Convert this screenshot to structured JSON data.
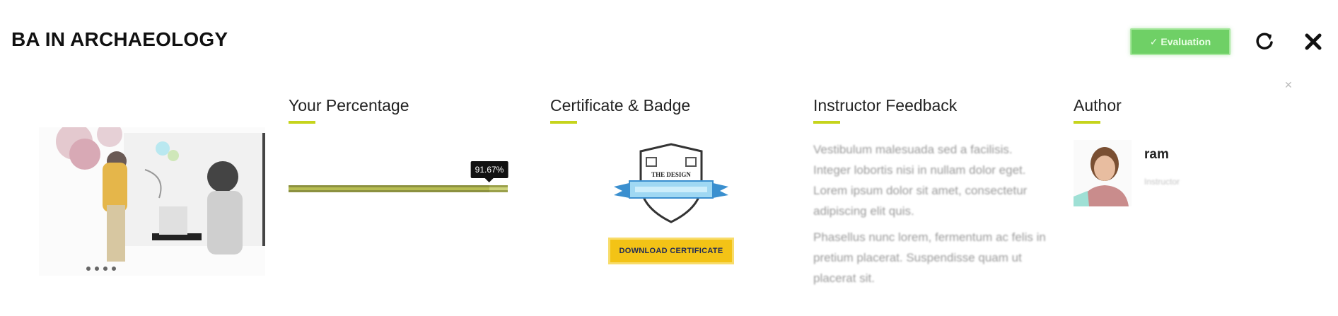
{
  "header": {
    "title": "BA IN ARCHAEOLOGY",
    "status_label": "✓ Evaluation",
    "refresh_icon": "refresh-icon",
    "close_icon": "close-icon"
  },
  "percentage": {
    "heading": "Your Percentage",
    "value": 91.67,
    "tooltip": "91.67%"
  },
  "certificate": {
    "heading": "Certificate & Badge",
    "badge_text": "THE DESIGN",
    "button_label": "DOWNLOAD CERTIFICATE"
  },
  "feedback": {
    "heading": "Instructor Feedback",
    "paragraphs": [
      "Vestibulum malesuada sed a facilisis. Integer lobortis nisi in nullam dolor eget. Lorem ipsum dolor sit amet, consectetur adipiscing elit quis.",
      "Phasellus nunc lorem, fermentum ac felis in pretium placerat. Suspendisse quam ut placerat sit."
    ]
  },
  "author": {
    "heading": "Author",
    "name": "ram",
    "subtitle": "Instructor"
  },
  "colors": {
    "accent_underline": "#c6d41c",
    "status_green": "#6fd066",
    "cert_yellow": "#f3c316"
  }
}
